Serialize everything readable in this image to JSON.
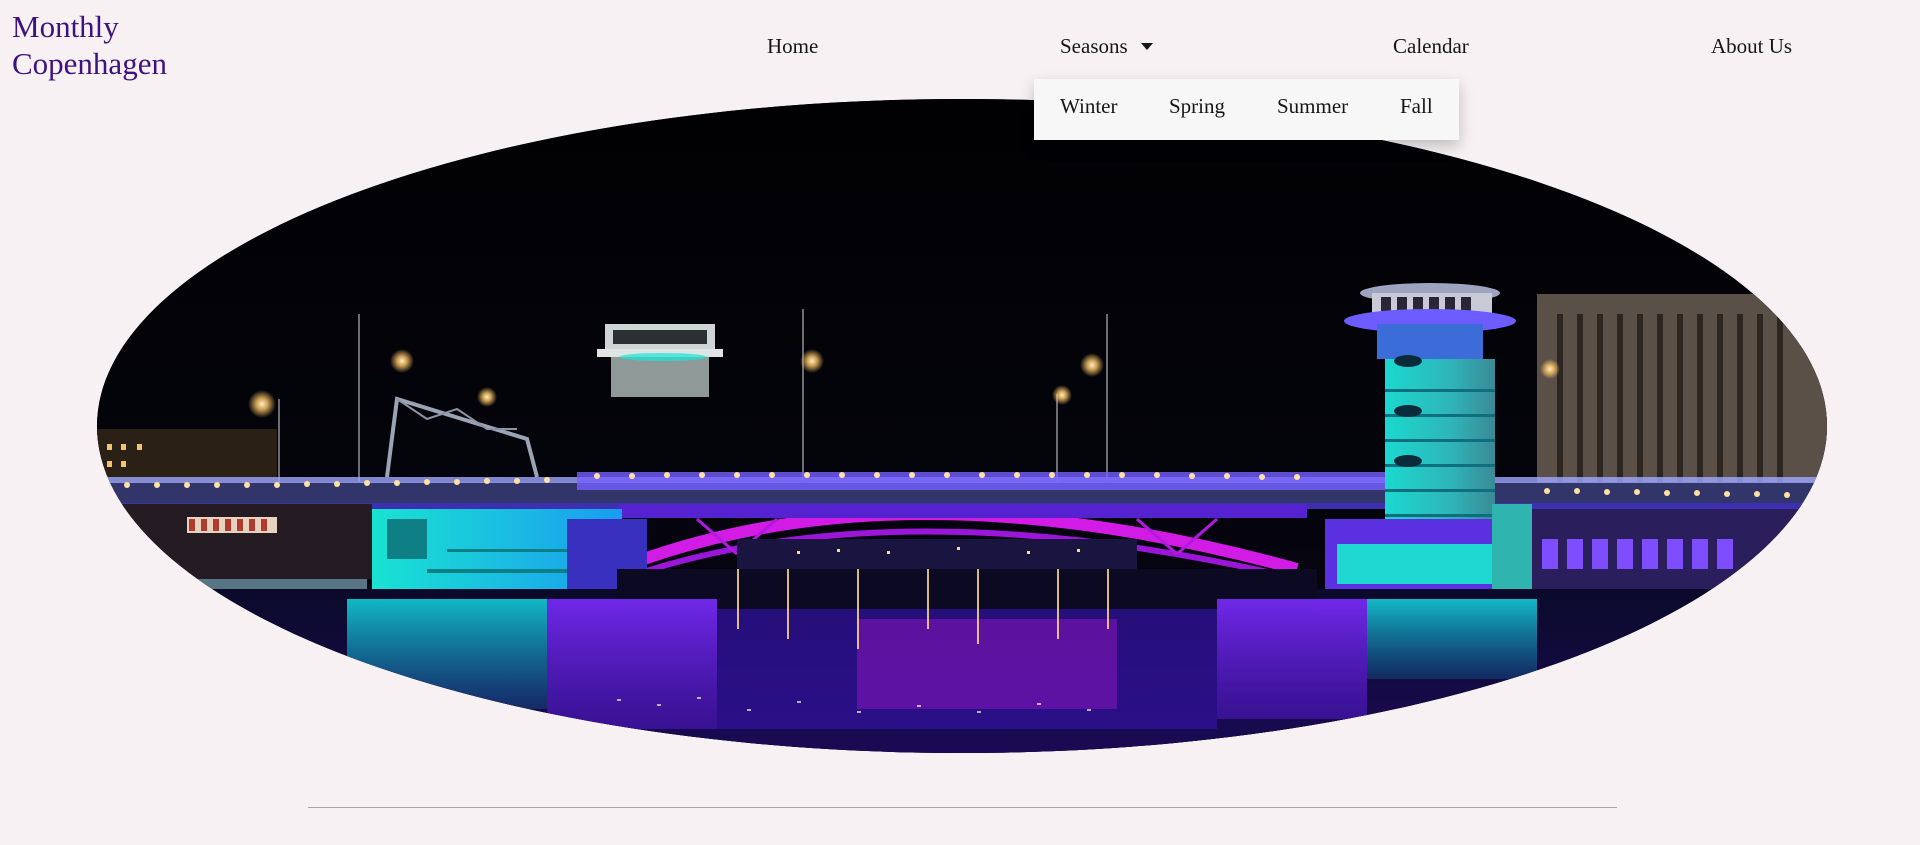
{
  "header": {
    "logo_text": "Monthly Copenhagen"
  },
  "nav": {
    "home": "Home",
    "seasons": "Seasons",
    "seasons_icon": "caret-down",
    "calendar": "Calendar",
    "about": "About Us"
  },
  "seasons_dropdown": {
    "open": true,
    "items": [
      "Winter",
      "Spring",
      "Summer",
      "Fall"
    ]
  },
  "hero": {
    "subject": "illuminated bascule bridge over harbour at night",
    "colors": {
      "sky": "#020206",
      "teal": "#19e3d2",
      "violet": "#6a24ff",
      "magenta": "#d21ce6",
      "lamp": "#ffd98a"
    }
  },
  "colors": {
    "background": "#f7f1f3",
    "logo": "#3f137f",
    "text": "#161616",
    "divider": "#a9a5a7"
  }
}
